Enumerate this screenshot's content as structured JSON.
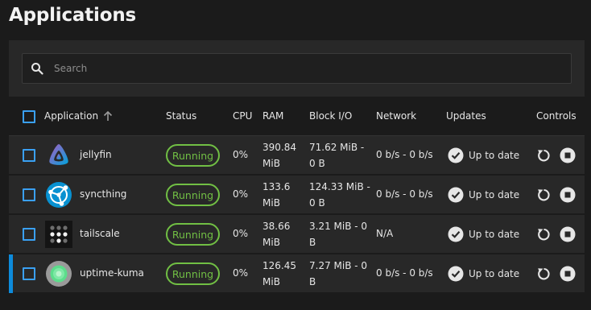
{
  "page": {
    "title": "Applications"
  },
  "search": {
    "placeholder": "Search",
    "value": ""
  },
  "table": {
    "columns": {
      "application": "Application",
      "status": "Status",
      "cpu": "CPU",
      "ram": "RAM",
      "block_io": "Block I/O",
      "network": "Network",
      "updates": "Updates",
      "controls": "Controls"
    },
    "rows": [
      {
        "name": "jellyfin",
        "logo": "jellyfin-logo",
        "status": "Running",
        "cpu": "0%",
        "ram": "390.84 MiB",
        "block_io": "71.62 MiB - 0 B",
        "network": "0 b/s - 0 b/s",
        "updates": "Up to date"
      },
      {
        "name": "syncthing",
        "logo": "syncthing-logo",
        "status": "Running",
        "cpu": "0%",
        "ram": "133.6 MiB",
        "block_io": "124.33 MiB - 0 B",
        "network": "0 b/s - 0 b/s",
        "updates": "Up to date"
      },
      {
        "name": "tailscale",
        "logo": "tailscale-logo",
        "status": "Running",
        "cpu": "0%",
        "ram": "38.66 MiB",
        "block_io": "3.21 MiB - 0 B",
        "network": "N/A",
        "updates": "Up to date"
      },
      {
        "name": "uptime-kuma",
        "logo": "uptime-kuma-logo",
        "status": "Running",
        "cpu": "0%",
        "ram": "126.45 MiB",
        "block_io": "7.27 MiB - 0 B",
        "network": "0 b/s - 0 b/s",
        "updates": "Up to date"
      }
    ]
  },
  "colors": {
    "accent": "#3aa0f3",
    "running": "#71bf44",
    "row_bg": "#282828",
    "page_bg": "#1b1b1b",
    "selected_indicator": "#0d8bdb"
  },
  "icons": [
    "search-icon",
    "sort-ascending-icon",
    "check-circle-icon",
    "restart-icon",
    "stop-icon"
  ]
}
